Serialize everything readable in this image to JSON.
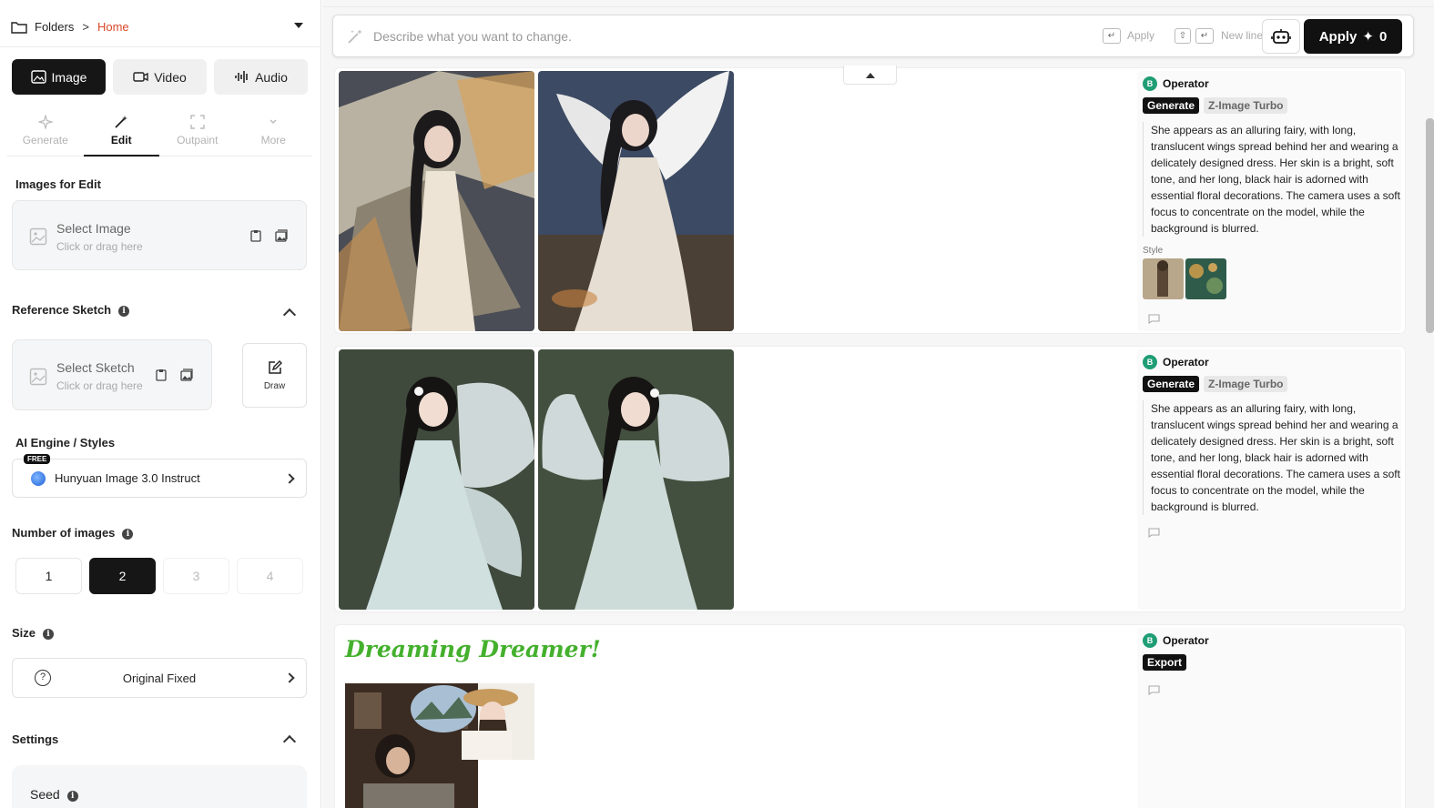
{
  "breadcrumb": {
    "root": "Folders",
    "separator": ">",
    "current": "Home"
  },
  "media_tabs": [
    {
      "label": "Image",
      "icon": "image-icon",
      "active": true
    },
    {
      "label": "Video",
      "icon": "video-icon",
      "active": false
    },
    {
      "label": "Audio",
      "icon": "audio-icon",
      "active": false
    }
  ],
  "mode_tabs": [
    {
      "label": "Generate",
      "icon": "sparkle-icon",
      "active": false
    },
    {
      "label": "Edit",
      "icon": "magic-wand-icon",
      "active": true
    },
    {
      "label": "Outpaint",
      "icon": "expand-icon",
      "active": false
    },
    {
      "label": "More",
      "icon": "chevron-down-icon",
      "active": false
    }
  ],
  "images_for_edit": {
    "label": "Images for Edit",
    "title": "Select Image",
    "subtitle": "Click or drag here"
  },
  "reference_sketch": {
    "label": "Reference Sketch",
    "title": "Select Sketch",
    "subtitle": "Click or drag here",
    "draw_label": "Draw"
  },
  "engine": {
    "label": "AI Engine / Styles",
    "badge": "FREE",
    "name": "Hunyuan Image 3.0 Instruct"
  },
  "num_images": {
    "label": "Number of images",
    "options": [
      "1",
      "2",
      "3",
      "4"
    ],
    "selected": "2"
  },
  "size": {
    "label": "Size",
    "value": "Original Fixed"
  },
  "settings": {
    "label": "Settings",
    "seed_label": "Seed"
  },
  "prompt": {
    "placeholder": "Describe what you want to change.",
    "apply_hint": "Apply",
    "newline_hint": "New line",
    "apply_button": "Apply",
    "credits": "0"
  },
  "cards": [
    {
      "operator": "Operator",
      "avatar": "B",
      "tags": [
        "Generate",
        "Z-Image Turbo"
      ],
      "description": "She appears as an alluring fairy, with long, translucent wings spread behind her and wearing a delicately designed dress. Her skin is a bright, soft tone, and her long, black hair is adorned with essential floral decorations. The camera uses a soft focus to concentrate on the model, while the background is blurred.",
      "style_label": "Style"
    },
    {
      "operator": "Operator",
      "avatar": "B",
      "tags": [
        "Generate",
        "Z-Image Turbo"
      ],
      "description": "She appears as an alluring fairy, with long, translucent wings spread behind her and wearing a delicately designed dress. Her skin is a bright, soft tone, and her long, black hair is adorned with essential floral decorations. The camera uses a soft focus to concentrate on the model, while the background is blurred."
    },
    {
      "operator": "Operator",
      "avatar": "B",
      "tags": [
        "Export"
      ],
      "title": "Dreaming Dreamer!"
    }
  ],
  "colors": {
    "accent_dark": "#161616",
    "breadcrumb_current": "#d9482b",
    "avatar": "#1f9d74",
    "dream_title": "#44b02d"
  }
}
